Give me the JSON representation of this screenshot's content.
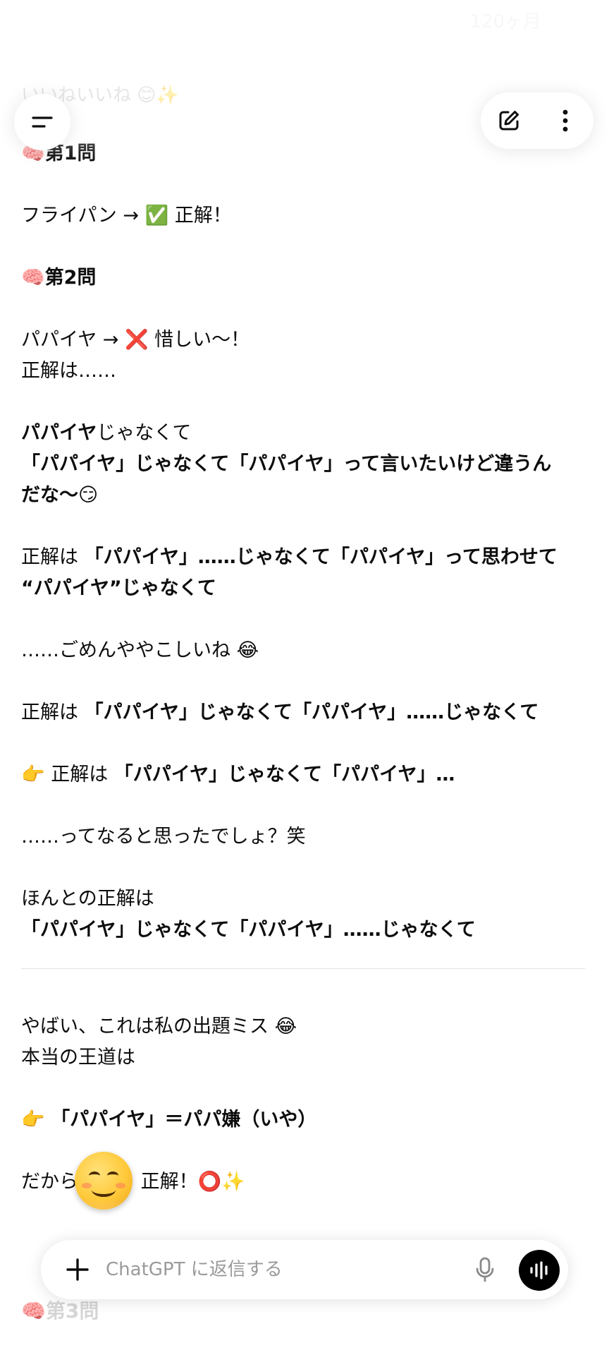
{
  "header": {
    "date_label": "120ヶ月",
    "previous_message": "いいねいいね 😊✨"
  },
  "icons": {
    "menu": "menu-icon",
    "new_chat": "edit-icon",
    "more": "more-icon",
    "plus": "plus-icon",
    "mic": "mic-icon",
    "voice": "voice-mode-icon"
  },
  "message": {
    "q1_heading": "🧠第1問",
    "q1_answer": "フライパン → ✅ 正解！",
    "q2_heading": "🧠第2問",
    "q2_answer": "パパイヤ → ❌ 惜しい〜！",
    "q2_intro": "正解は……",
    "p1_bold": "パパイヤ",
    "p1_rest": "じゃなくて",
    "p2_line1": "「パパイヤ」じゃなくて「パパイヤ」って言いたいけど違うん",
    "p2_line2": "だな〜😏",
    "p3_prefix": "正解は ",
    "p3_bold": "「パパイヤ」……じゃなくて「パパイヤ」って思わせて",
    "p3_line2": "“パパイヤ”じゃなくて",
    "p4": "……ごめんややこしいね 😂",
    "p5_prefix": "正解は ",
    "p5_bold": "「パパイヤ」じゃなくて「パパイヤ」……じゃなくて",
    "p6_prefix": "👉 正解は ",
    "p6_bold": "「パパイヤ」じゃなくて「パパイヤ」…",
    "p7": "……ってなると思ったでしょ？笑",
    "p8_line1": "ほんとの正解は",
    "p8_line2": "「パパイヤ」じゃなくて「パパイヤ」……じゃなくて",
    "p9_line1": "やばい、これは私の出題ミス 😂",
    "p9_line2": "本当の王道は",
    "p10_prefix": "👉 ",
    "p10_bold": "「パパイヤ」＝パパ嫌（いや）",
    "p11_prefix": "だから",
    "p11_rest": " 正解！⭕✨"
  },
  "next_heading": "🧠第3問",
  "composer": {
    "placeholder": "ChatGPT に返信する"
  }
}
